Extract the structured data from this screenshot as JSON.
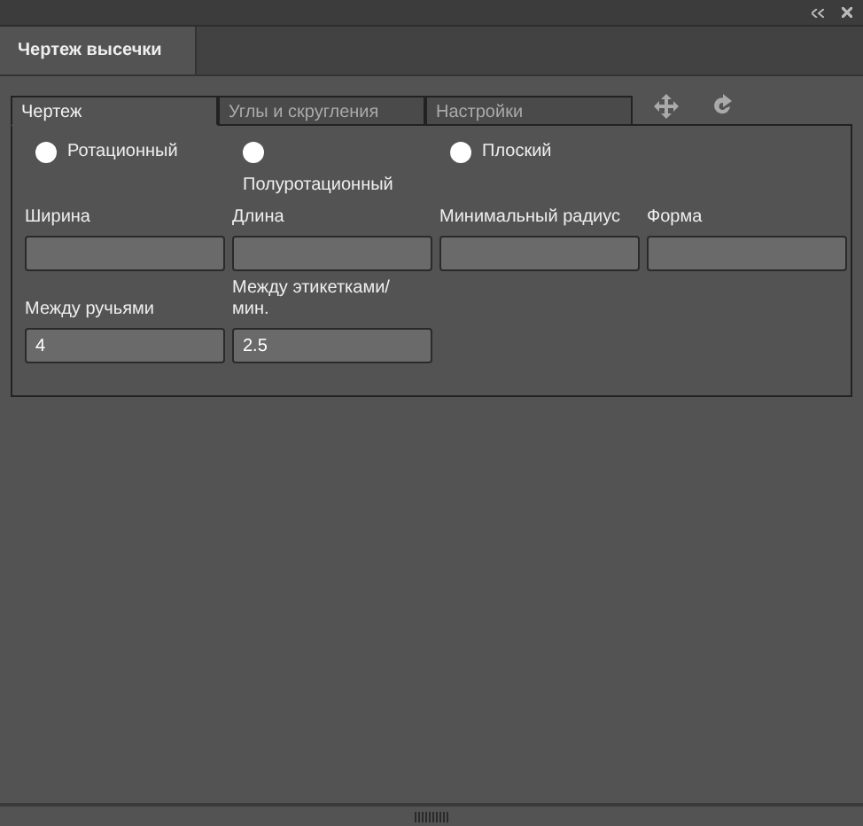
{
  "panel_tab": {
    "label": "Чертеж высечки",
    "selected": true
  },
  "tabs": [
    {
      "label": "Чертеж",
      "selected": true
    },
    {
      "label": "Углы и скругления",
      "selected": false
    },
    {
      "label": "Настройки",
      "selected": false
    }
  ],
  "shape_options": [
    {
      "label": "Ротационный",
      "selected": false,
      "wrap": false
    },
    {
      "label": "Полуротационный",
      "selected": false,
      "wrap": true
    },
    {
      "label": "Плоский",
      "selected": false,
      "wrap": false
    }
  ],
  "fields": [
    {
      "label": "Ширина"
    },
    {
      "label": "Длина"
    },
    {
      "label": "Минимальный радиус"
    },
    {
      "label": "Форма"
    },
    {
      "label": "Между ручьями",
      "value": "4"
    },
    {
      "label": "Между этикетками/ мин.",
      "value": "2.5"
    }
  ]
}
